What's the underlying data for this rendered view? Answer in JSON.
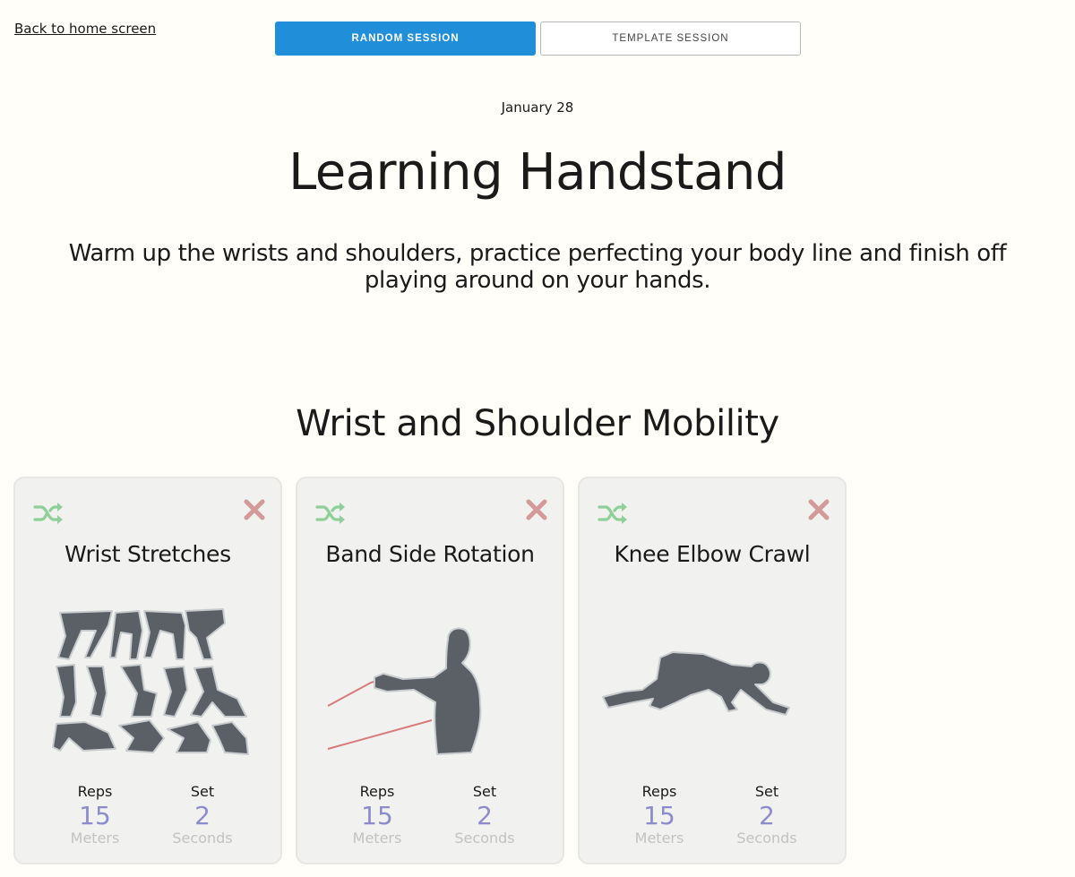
{
  "nav": {
    "back_label": "Back to home screen"
  },
  "session_toggle": {
    "random_label": "RANDOM SESSION",
    "template_label": "TEMPLATE SESSION",
    "active": "random"
  },
  "session": {
    "date": "January 28",
    "title": "Learning Handstand",
    "description": "Warm up the wrists and shoulders, practice perfecting your body line and finish off playing around on your hands."
  },
  "section": {
    "title": "Wrist and Shoulder Mobility"
  },
  "icons": {
    "shuffle": "shuffle-icon",
    "remove": "close-icon"
  },
  "colors": {
    "accent_blue": "#208ed9",
    "shuffle_green": "#8fd09a",
    "remove_red": "#d49a9a",
    "value_purple": "#8c8ccc",
    "unit_gray": "#c2c2c2",
    "silhouette": "#5a6066",
    "band_red": "#d97a7a"
  },
  "exercises": [
    {
      "name": "Wrist Stretches",
      "image": "wrist-stretches-illustration",
      "reps_label": "Reps",
      "reps_value": "15",
      "reps_unit": "Meters",
      "set_label": "Set",
      "set_value": "2",
      "set_unit": "Seconds"
    },
    {
      "name": "Band Side Rotation",
      "image": "band-side-rotation-illustration",
      "reps_label": "Reps",
      "reps_value": "15",
      "reps_unit": "Meters",
      "set_label": "Set",
      "set_value": "2",
      "set_unit": "Seconds"
    },
    {
      "name": "Knee Elbow Crawl",
      "image": "knee-elbow-crawl-illustration",
      "reps_label": "Reps",
      "reps_value": "15",
      "reps_unit": "Meters",
      "set_label": "Set",
      "set_value": "2",
      "set_unit": "Seconds"
    }
  ]
}
